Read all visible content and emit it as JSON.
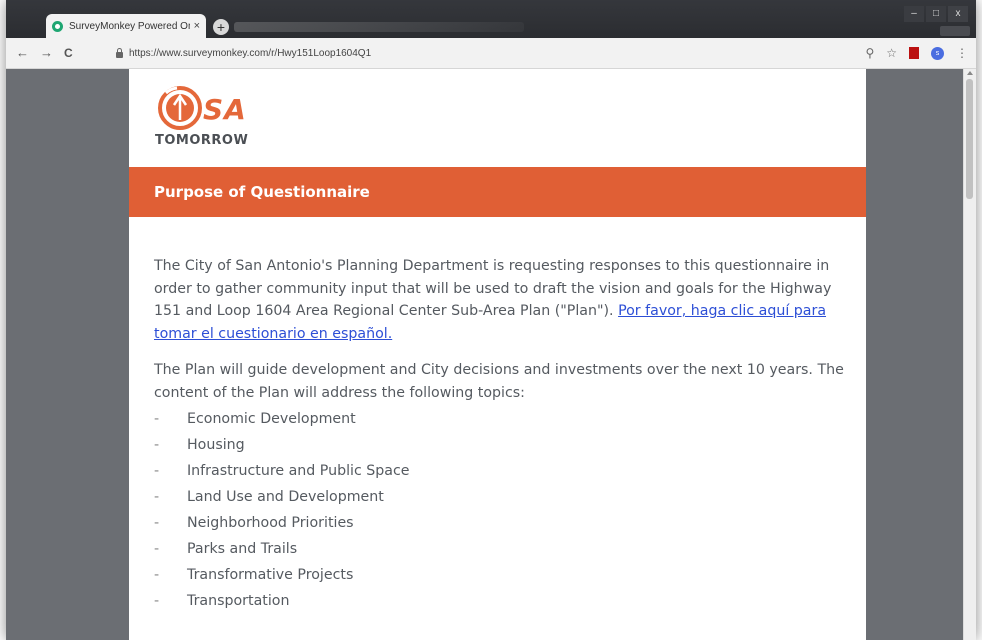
{
  "browser": {
    "tab_title": "SurveyMonkey Powered Online",
    "tab_close": "×",
    "new_tab": "+",
    "url": "https://www.surveymonkey.com/r/Hwy151Loop1604Q1",
    "nav": {
      "back": "←",
      "forward": "→",
      "reload": "C"
    },
    "toolbar_icons": {
      "zoom": "⚲",
      "star": "☆",
      "profile": "s"
    },
    "window_buttons": {
      "minimize": "–",
      "maximize": "□",
      "close": "x"
    }
  },
  "logo": {
    "sa": "SA",
    "tomorrow": "TOMORROW",
    "accent_color": "#e4683a"
  },
  "banner": {
    "title": "Purpose of Questionnaire",
    "color": "#e05f35"
  },
  "intro": {
    "text": "The City of San Antonio's Planning Department is requesting responses to this questionnaire in order to gather community input that will be used to draft the vision and goals for the Highway 151 and Loop 1604 Area Regional Center Sub-Area Plan (\"Plan\").  ",
    "link": "Por favor, haga clic aquí para tomar el cuestionario en español."
  },
  "plan_text": "The Plan will guide development and City decisions and investments over the next 10 years.  The content of the Plan will address the following topics:",
  "topics": [
    {
      "dash": "-",
      "label": "Economic Development"
    },
    {
      "dash": "-",
      "label": "Housing"
    },
    {
      "dash": "-",
      "label": "Infrastructure and Public Space"
    },
    {
      "dash": "-",
      "label": "Land Use and Development"
    },
    {
      "dash": "-",
      "label": "Neighborhood Priorities"
    },
    {
      "dash": "-",
      "label": "Parks and Trails"
    },
    {
      "dash": "-",
      "label": "Transformative Projects"
    },
    {
      "dash": "-",
      "label": "Transportation"
    }
  ]
}
